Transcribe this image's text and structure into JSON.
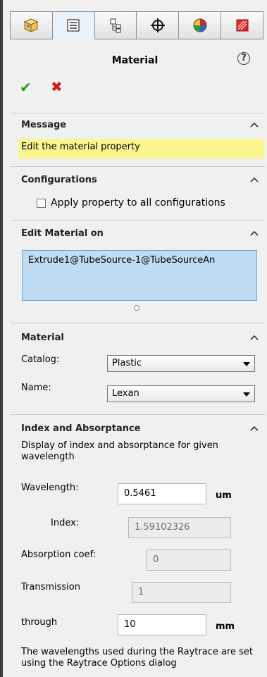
{
  "tabs": [
    {
      "name": "feature-manager",
      "icon": "part-icon"
    },
    {
      "name": "property-manager",
      "icon": "property-list-icon"
    },
    {
      "name": "configuration-manager",
      "icon": "configuration-icon"
    },
    {
      "name": "dimxpert-manager",
      "icon": "crosshair-icon"
    },
    {
      "name": "display-manager",
      "icon": "appearance-ball-icon"
    },
    {
      "name": "raytrace-manager",
      "icon": "raytrace-icon"
    }
  ],
  "panel": {
    "title": "Material",
    "help_glyph": "?",
    "ok_glyph": "✔",
    "cancel_glyph": "✖"
  },
  "message": {
    "title": "Message",
    "text": "Edit the material property"
  },
  "configurations": {
    "title": "Configurations",
    "checkbox_label": "Apply property to all configurations",
    "checked": false
  },
  "edit_material": {
    "title": "Edit Material on",
    "items": [
      "Extrude1@TubeSource-1@TubeSourceAn"
    ]
  },
  "material": {
    "title": "Material",
    "catalog_label": "Catalog:",
    "catalog_value": "Plastic",
    "name_label": "Name:",
    "name_value": "Lexan"
  },
  "index_absorptance": {
    "title": "Index and Absorptance",
    "description": "Display of index and absorptance for given wavelength",
    "wavelength_label": "Wavelength:",
    "wavelength_value": "0.5461",
    "wavelength_unit": "um",
    "index_label": "Index:",
    "index_value": "1.59102326",
    "absorption_label": "Absorption coef:",
    "absorption_value": "0",
    "transmission_label": "Transmission",
    "transmission_value": "1",
    "through_label": "through",
    "through_value": "10",
    "through_unit": "mm",
    "footer": "The wavelengths used during the Raytrace are set using the Raytrace Options dialog"
  },
  "colors": {
    "message_bg": "#fbf68f",
    "selection_bg": "#bfdcf5",
    "ok": "#1f9d1f",
    "cancel": "#d21b1b"
  }
}
